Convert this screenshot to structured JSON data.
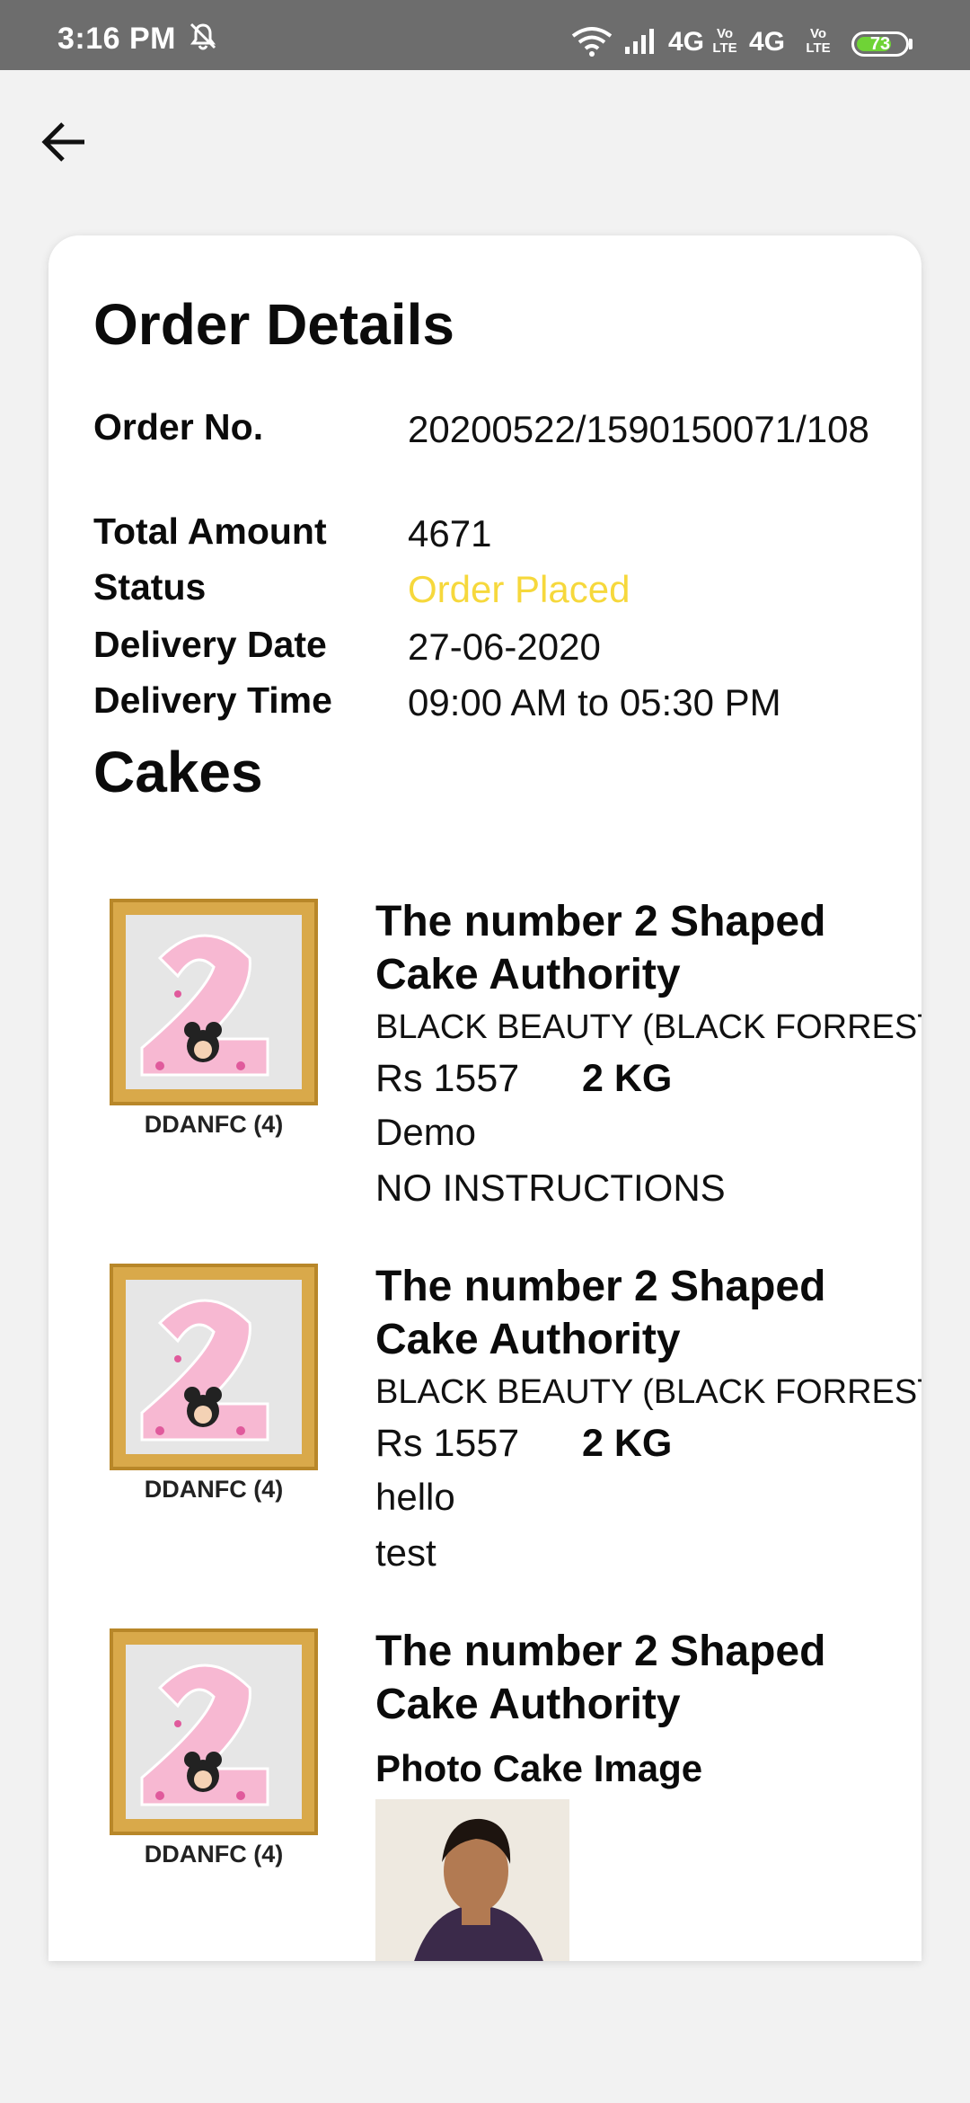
{
  "status_bar": {
    "time": "3:16 PM",
    "network1": "4G",
    "network2": "4G",
    "volte": "Vo\nLTE",
    "battery_level": "73",
    "battery_fraction": 0.73,
    "icons": [
      "mute-icon",
      "wifi-icon",
      "signal-icon",
      "battery-icon"
    ]
  },
  "header": {
    "back_icon": "arrow-left-icon"
  },
  "order": {
    "title": "Order Details",
    "fields": {
      "order_no_label": "Order No.",
      "order_no": "20200522/1590150071/108",
      "total_label": "Total Amount",
      "total": "4671",
      "status_label": "Status",
      "status": "Order Placed",
      "delivery_date_label": "Delivery Date",
      "delivery_date": "27-06-2020",
      "delivery_time_label": "Delivery Time",
      "delivery_time": "09:00 AM to 05:30 PM"
    },
    "status_color": "#f6d83c"
  },
  "cakes": {
    "title": "Cakes",
    "items": [
      {
        "caption": "DDANFC (4)",
        "name": "The number 2 Shaped Cake Authority",
        "flavour": "BLACK BEAUTY (BLACK FORREST)",
        "price": "Rs 1557",
        "weight": "2 KG",
        "message": "Demo",
        "instructions": "NO INSTRUCTIONS"
      },
      {
        "caption": "DDANFC (4)",
        "name": "The number 2 Shaped Cake Authority",
        "flavour": "BLACK BEAUTY (BLACK FORREST)",
        "price": "Rs 1557",
        "weight": "2 KG",
        "message": "hello",
        "instructions": "test"
      },
      {
        "caption": "DDANFC (4)",
        "name": "The number 2 Shaped Cake Authority",
        "photo_label": "Photo Cake Image"
      }
    ]
  }
}
